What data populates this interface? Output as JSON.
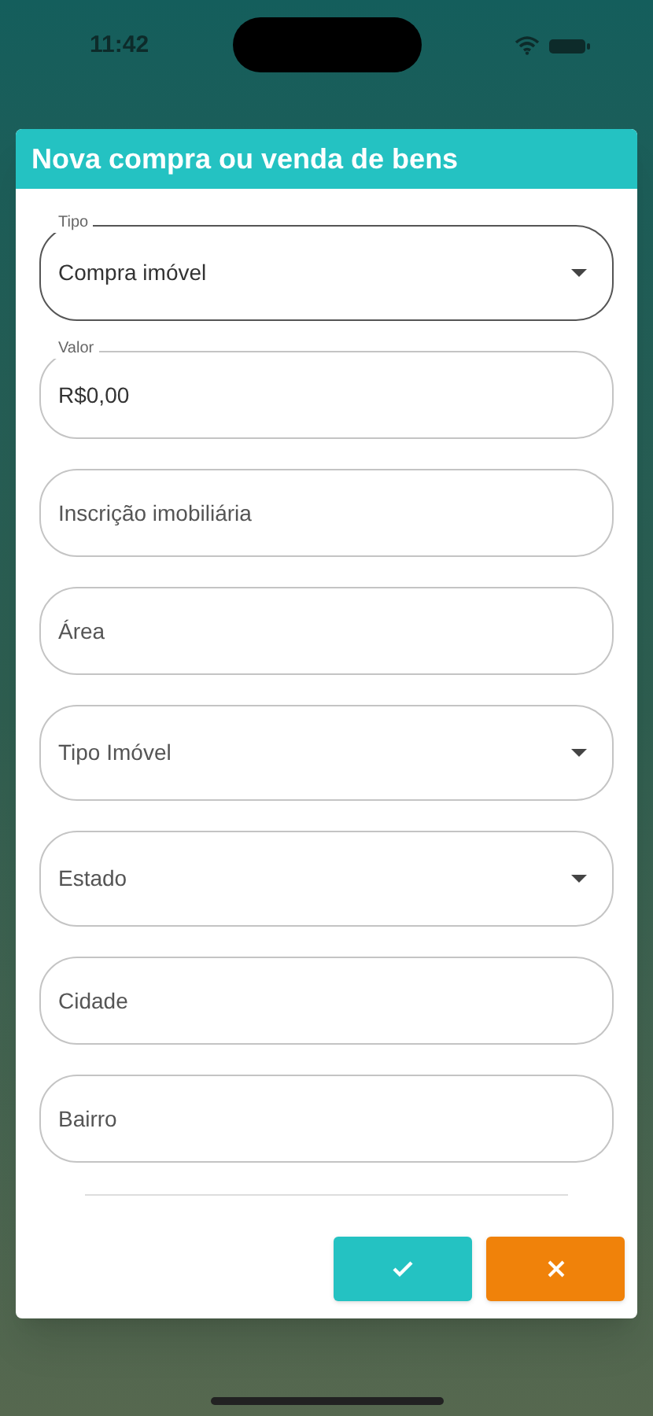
{
  "status_bar": {
    "time": "11:42"
  },
  "dialog": {
    "title": "Nova compra ou venda de bens",
    "fields": [
      {
        "kind": "select",
        "label": "Tipo",
        "value": "Compra imóvel",
        "focused": true
      },
      {
        "kind": "text",
        "label": "Valor",
        "value": "R$0,00",
        "focused": false
      },
      {
        "kind": "text",
        "placeholder": "Inscrição imobiliária",
        "focused": false
      },
      {
        "kind": "text",
        "placeholder": "Área",
        "focused": false
      },
      {
        "kind": "select",
        "placeholder": "Tipo Imóvel",
        "focused": false
      },
      {
        "kind": "select",
        "placeholder": "Estado",
        "focused": false
      },
      {
        "kind": "text",
        "placeholder": "Cidade",
        "focused": false
      },
      {
        "kind": "text",
        "placeholder": "Bairro",
        "focused": false
      }
    ],
    "buttons": [
      {
        "kind": "confirm"
      },
      {
        "kind": "cancel"
      }
    ]
  }
}
